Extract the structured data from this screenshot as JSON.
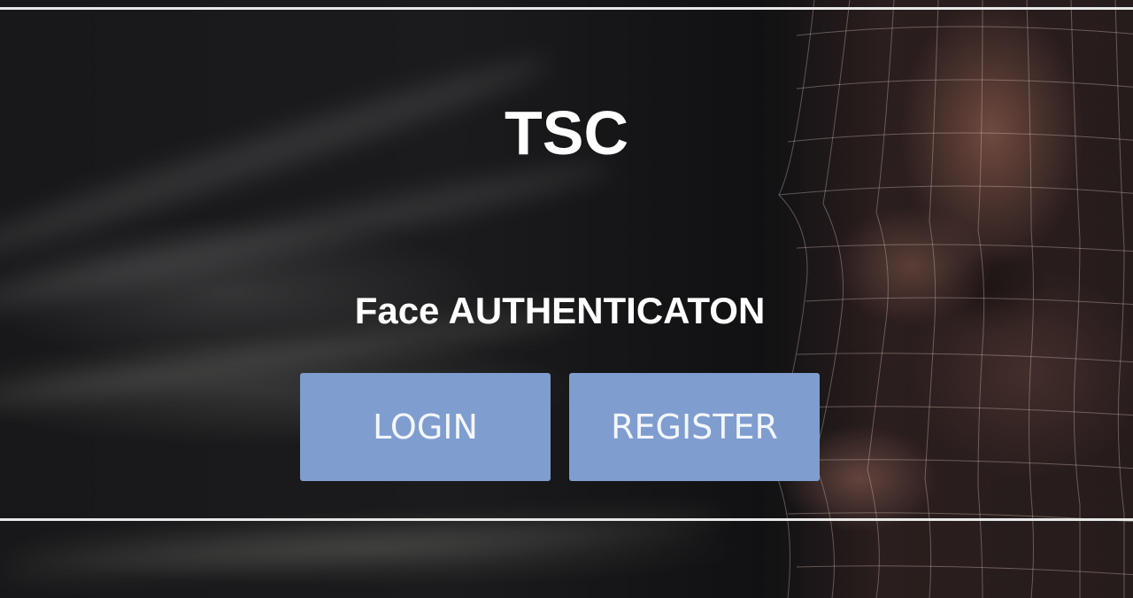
{
  "header": {
    "title": "TSC"
  },
  "main": {
    "subtitle": "Face AUTHENTICATON",
    "buttons": {
      "login_label": "LOGIN",
      "register_label": "REGISTER"
    }
  },
  "colors": {
    "button_bg": "#7f9dcf",
    "button_text": "#f3f6fb",
    "text": "#ffffff",
    "divider": "#e8e8e8"
  }
}
